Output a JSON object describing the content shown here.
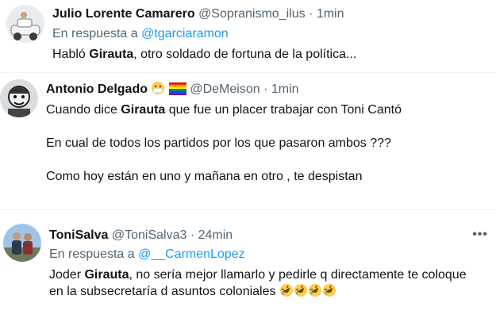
{
  "tweets": [
    {
      "name": "Julio Lorente Camarero",
      "handle": "@Sopranismo_ilus",
      "time": "1min",
      "reply_prefix": "En respuesta a",
      "reply_to": "@tgarciaramon",
      "text_parts": [
        "Habló ",
        "Girauta",
        ", otro soldado de fortuna de la política..."
      ],
      "avatar_icon": "car-toy-avatar"
    },
    {
      "name": "Antonio Delgado",
      "handle": "@DeMeison",
      "time": "1min",
      "name_emojis": [
        "face-with-medical-mask",
        "rainbow-flag"
      ],
      "line1_parts": [
        "Cuando dice ",
        "Girauta",
        " que fue un placer trabajar con Toni Cantó"
      ],
      "line2": "En cual de todos los partidos por los que pasaron ambos ???",
      "line3": "Como hoy están en uno y mañana en otro , te despistan",
      "avatar_icon": "cartoon-man-avatar"
    },
    {
      "name": "ToniSalva",
      "handle": "@ToniSalva3",
      "time": "24min",
      "reply_prefix": "En respuesta a",
      "reply_to": "@__CarmenLopez",
      "line1_parts": [
        "Joder ",
        "Girauta",
        ", no sería mejor llamarlo y pedirle q directamente te coloque"
      ],
      "line2": "en la subsecretaría d asuntos coloniales",
      "trailing_emojis": [
        "rolling-on-floor-laughing",
        "rolling-on-floor-laughing",
        "rolling-on-floor-laughing",
        "rolling-on-floor-laughing"
      ],
      "more_label": "•••",
      "avatar_icon": "two-people-photo-avatar"
    }
  ],
  "separator": "·"
}
